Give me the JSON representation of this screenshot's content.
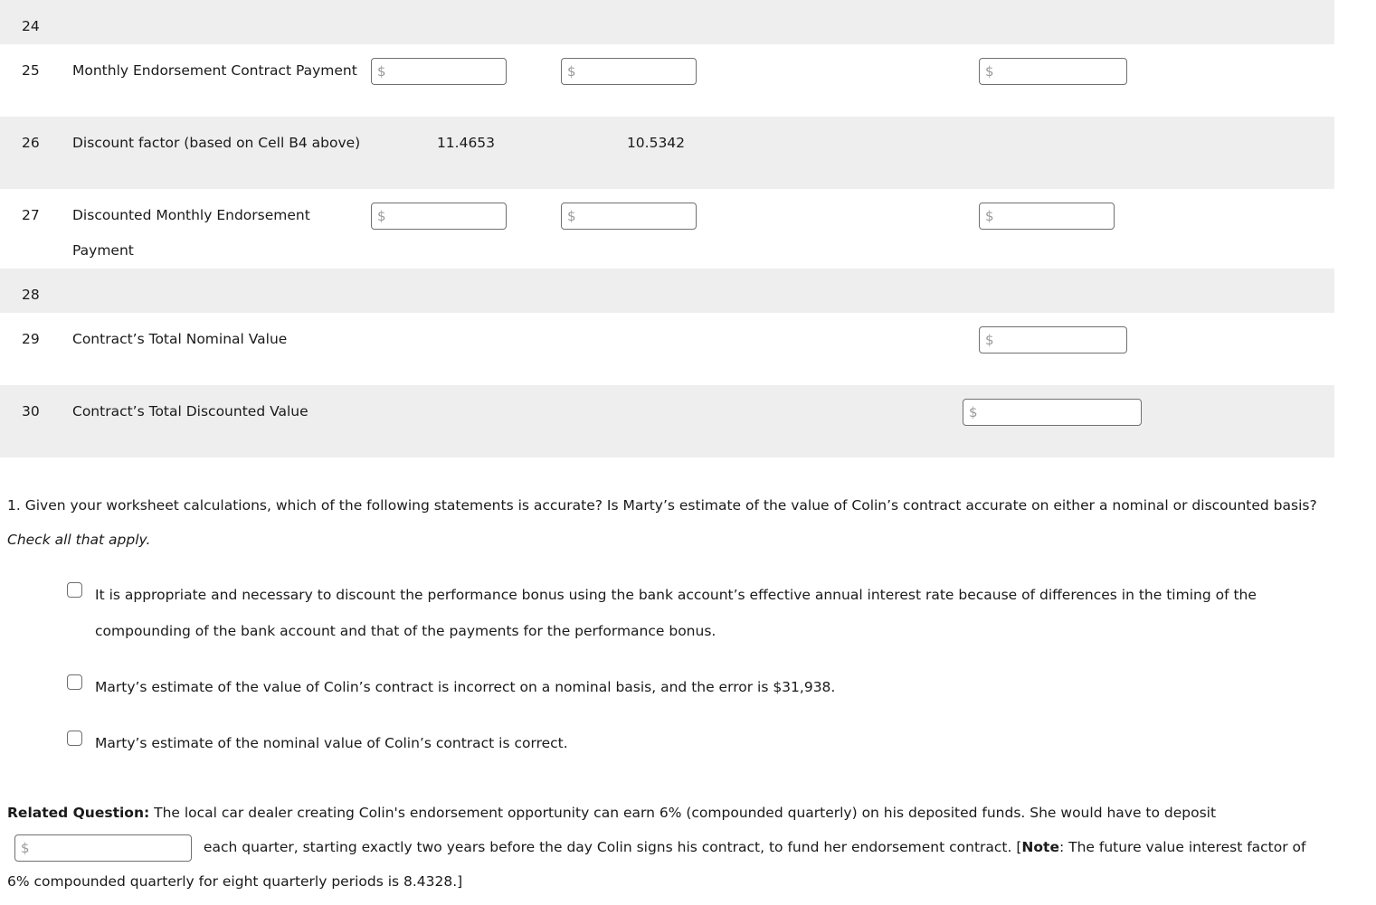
{
  "worksheet": {
    "rows": [
      {
        "number": "24",
        "label": "",
        "col_b": "",
        "col_c": "",
        "col_e": ""
      },
      {
        "number": "25",
        "label": "Monthly Endorsement Contract Payment",
        "col_b_placeholder": "$",
        "col_c_placeholder": "$",
        "col_e_placeholder": "$"
      },
      {
        "number": "26",
        "label": "Discount factor (based on Cell B4 above)",
        "col_b": "11.4653",
        "col_c": "10.5342"
      },
      {
        "number": "27",
        "label": "Discounted Monthly Endorsement Payment",
        "col_b_placeholder": "$",
        "col_c_placeholder": "$",
        "col_e_placeholder": "$"
      },
      {
        "number": "28",
        "label": ""
      },
      {
        "number": "29",
        "label": "Contract’s Total Nominal Value",
        "col_e_placeholder": "$"
      },
      {
        "number": "30",
        "label": "Contract’s Total Discounted Value",
        "col_e_placeholder": "$"
      }
    ]
  },
  "question": {
    "part1": "1. Given your worksheet calculations, which of the following statements is accurate? Is Marty’s estimate of the value of Colin’s contract accurate on either a nominal or discounted basis? ",
    "emphasis": "Check all that apply.",
    "options": [
      "It is appropriate and necessary to discount the performance bonus using the bank account’s effective annual interest rate because of differences in the timing of the compounding of the bank account and that of the payments for the performance bonus.",
      "Marty’s estimate of the value of Colin’s contract is incorrect on a nominal basis, and the error is $31,938.",
      "Marty’s estimate of the nominal value of Colin’s contract is correct."
    ]
  },
  "related_question": {
    "label": "Related Question:",
    "text_before_input": " The local car dealer creating Colin's endorsement opportunity can earn 6% (compounded quarterly) on his deposited funds. She would have to deposit ",
    "input_placeholder": "$",
    "text_after_input": " each quarter, starting exactly two years before the day Colin signs his contract, to fund her endorsement contract. [",
    "note_label": "Note",
    "note_text": ": The future value interest factor of 6% compounded quarterly for eight quarterly periods is 8.4328.]"
  },
  "colors": {
    "row_shaded": "#eeeeee",
    "row_plain": "#ffffff",
    "text": "#1a1a1a",
    "input_border": "#707070",
    "placeholder": "#9a9a9a"
  }
}
